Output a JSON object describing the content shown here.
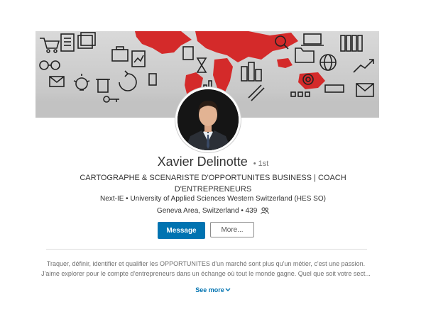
{
  "profile": {
    "name": "Xavier Delinotte",
    "degree": "• 1st",
    "headline": "CARTOGRAPHE & SCENARISTE D'OPPORTUNITES BUSINESS | COACH D'ENTREPRENEURS",
    "education": "Next-IE • University of Applied Sciences Western Switzerland (HES SO)",
    "location": "Geneva Area, Switzerland • 439",
    "connections_icon": "connections-icon"
  },
  "actions": {
    "message_label": "Message",
    "more_label": "More..."
  },
  "summary": {
    "line1": "Traquer, définir, identifier et qualifier les OPPORTUNITES d'un marché sont plus qu'un métier, c'est une passion.",
    "line2": "J'aime explorer pour le compte d'entrepreneurs dans un échange où tout le monde gagne. Quel que soit votre sect...",
    "see_more_label": "See more"
  },
  "colors": {
    "primary_blue": "#0073b1",
    "map_red": "#d52b2b"
  }
}
